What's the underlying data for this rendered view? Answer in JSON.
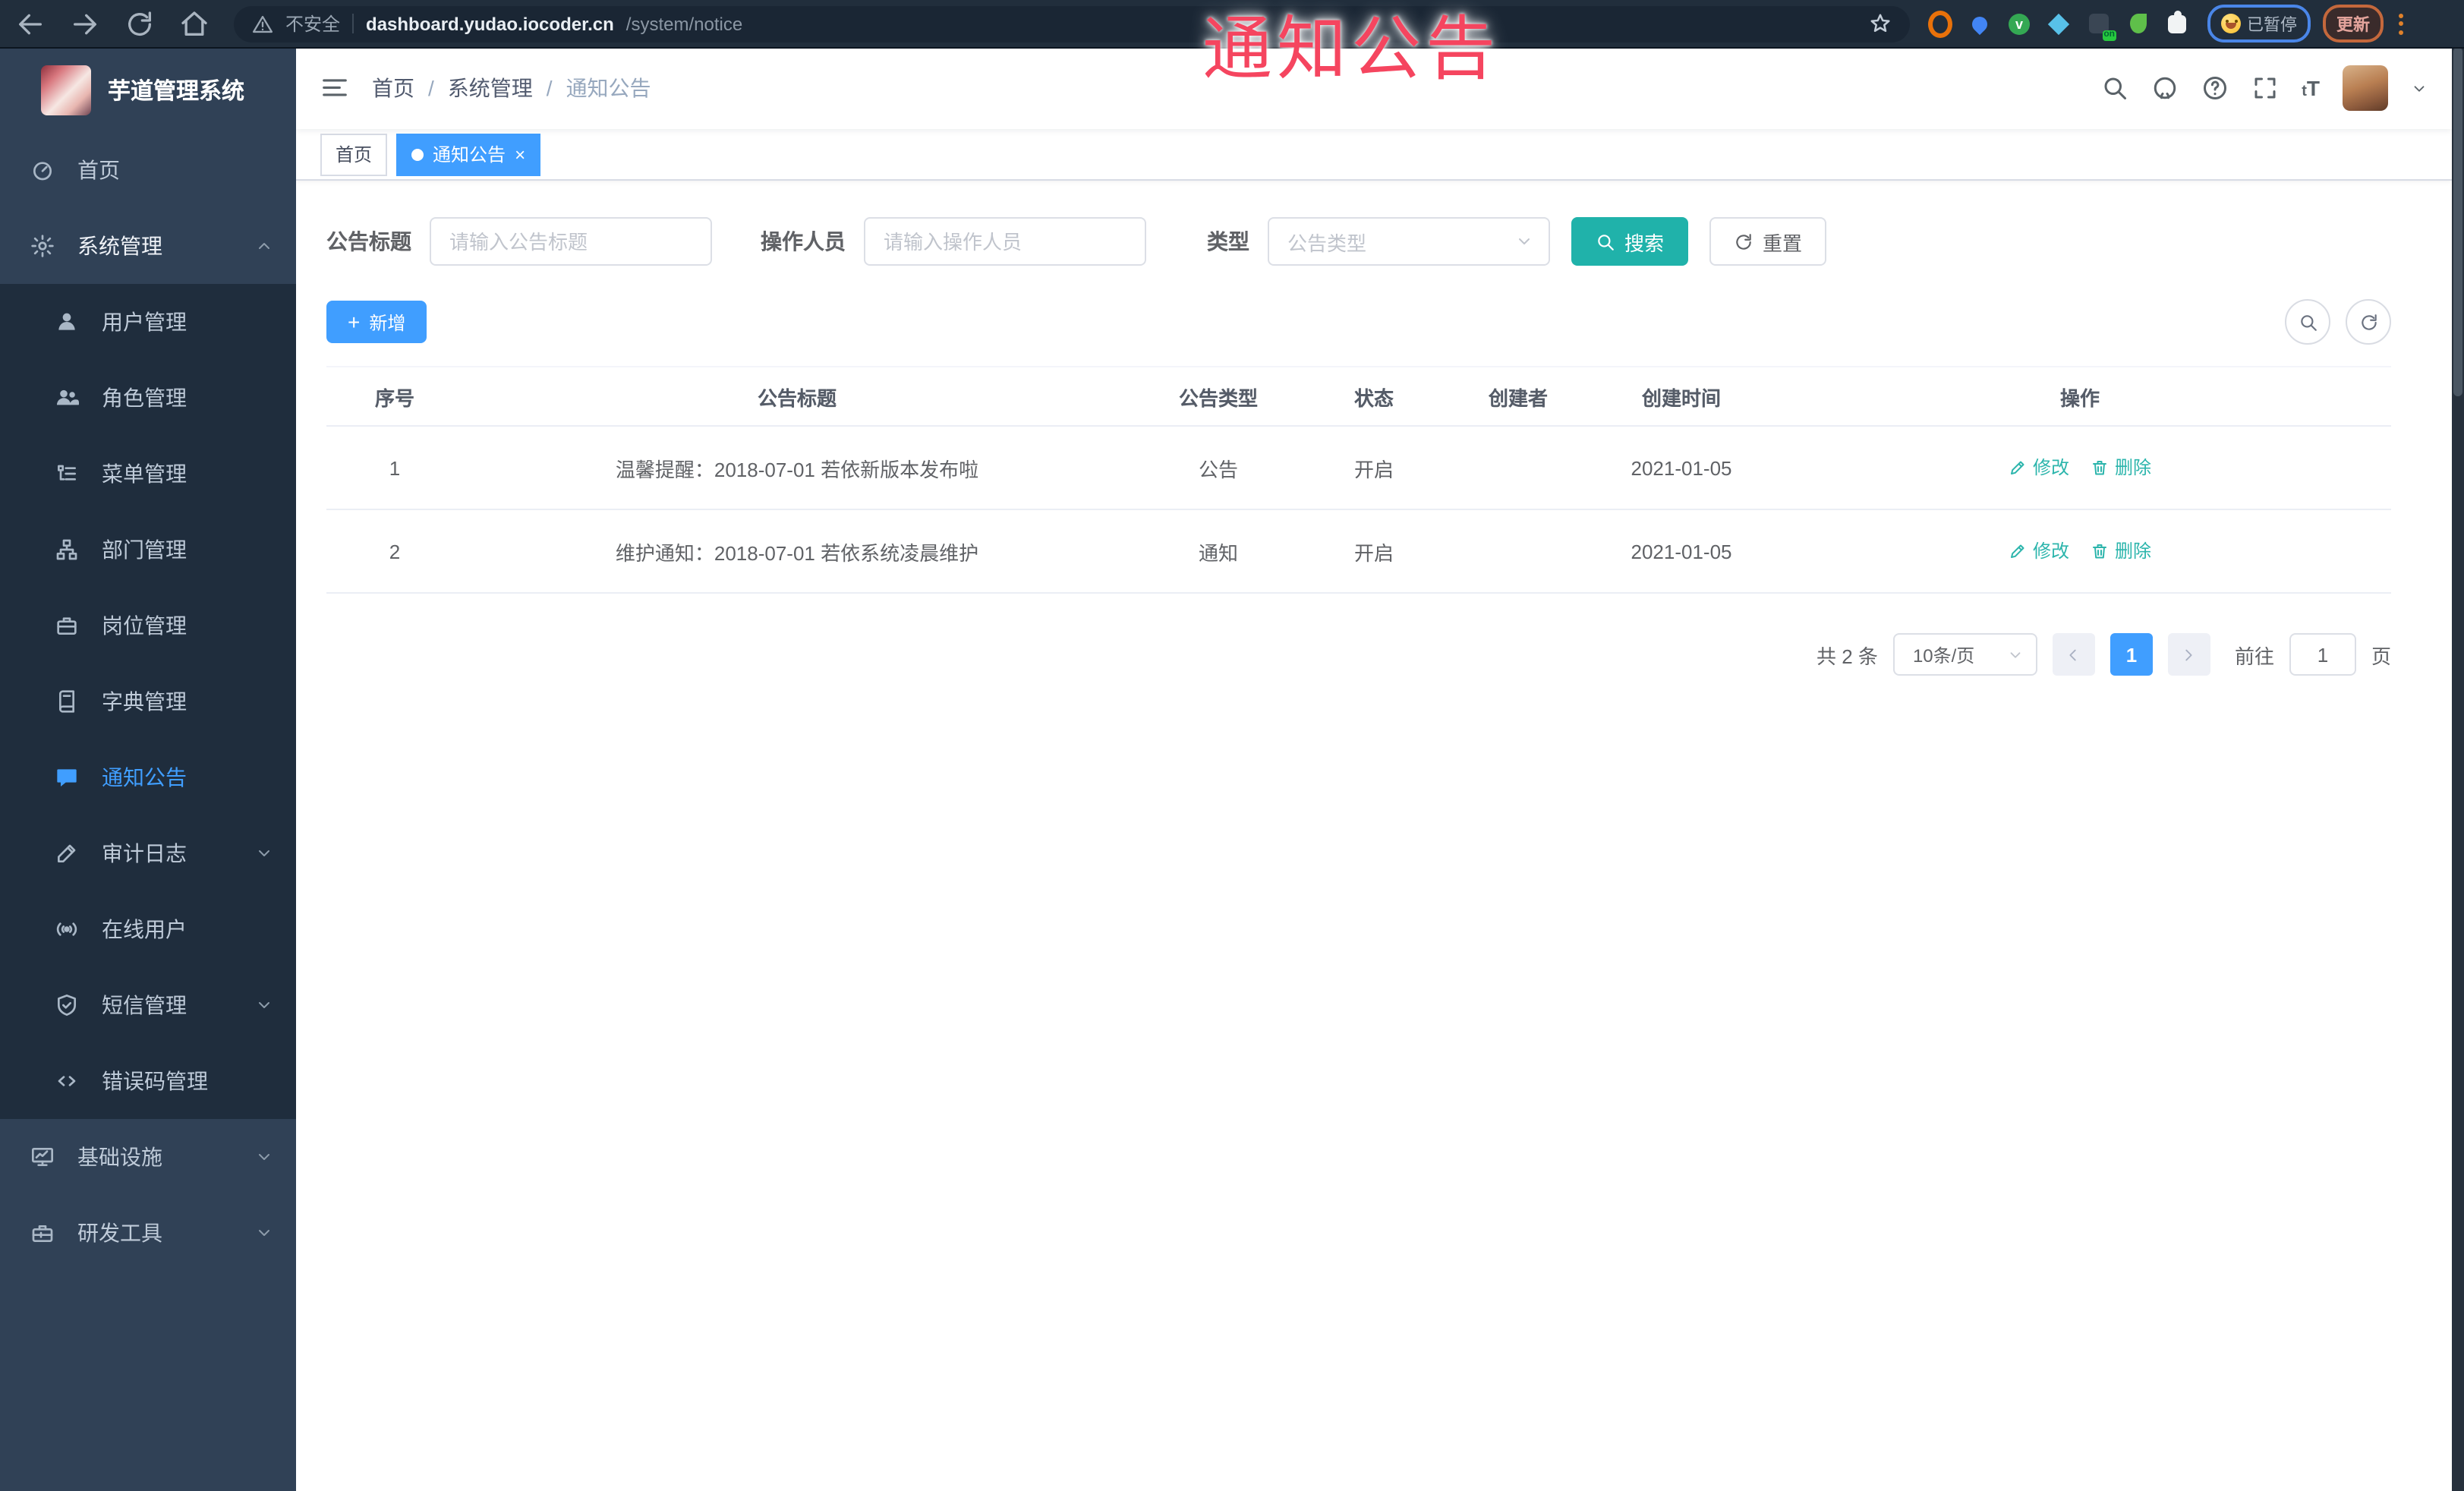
{
  "browser": {
    "security_label": "不安全",
    "url_host": "dashboard.yudao.iocoder.cn",
    "url_path": "/system/notice",
    "paused_label": "已暂停",
    "update_label": "更新",
    "nav_icons": [
      "back-icon",
      "forward-icon",
      "reload-icon",
      "home-icon"
    ],
    "extensions": [
      {
        "name": "extension-orange-ring-icon",
        "shape": "donut"
      },
      {
        "name": "extension-blue-pin-icon",
        "shape": "pin"
      },
      {
        "name": "extension-green-circle-icon",
        "shape": "circle",
        "glyph": "v"
      },
      {
        "name": "extension-blue-gem-icon",
        "shape": "diamond"
      },
      {
        "name": "extension-dark-icon",
        "shape": "square",
        "badge": "on"
      },
      {
        "name": "extension-green-leaf-icon",
        "shape": "leaf"
      },
      {
        "name": "extensions-puzzle-icon",
        "shape": "puzzle"
      }
    ]
  },
  "watermark": {
    "text": "通知公告",
    "color": "#f5455f"
  },
  "sidebar": {
    "title": "芋道管理系统",
    "items": [
      {
        "key": "home",
        "label": "首页",
        "icon": "dashboard-icon",
        "level": "top"
      },
      {
        "key": "system-management",
        "label": "系统管理",
        "icon": "gear-icon",
        "level": "top",
        "expanded": true,
        "arrow": "up"
      },
      {
        "key": "user-management",
        "label": "用户管理",
        "icon": "user-icon",
        "level": "sub"
      },
      {
        "key": "role-management",
        "label": "角色管理",
        "icon": "users-icon",
        "level": "sub"
      },
      {
        "key": "menu-management",
        "label": "菜单管理",
        "icon": "menu-tree-icon",
        "level": "sub"
      },
      {
        "key": "dept-management",
        "label": "部门管理",
        "icon": "org-tree-icon",
        "level": "sub"
      },
      {
        "key": "post-management",
        "label": "岗位管理",
        "icon": "briefcase-icon",
        "level": "sub"
      },
      {
        "key": "dict-management",
        "label": "字典管理",
        "icon": "book-icon",
        "level": "sub"
      },
      {
        "key": "notice-announcement",
        "label": "通知公告",
        "icon": "message-icon",
        "level": "sub",
        "active": true
      },
      {
        "key": "audit-log",
        "label": "审计日志",
        "icon": "edit-icon",
        "level": "sub",
        "arrow": "down"
      },
      {
        "key": "online-users",
        "label": "在线用户",
        "icon": "online-icon",
        "level": "sub"
      },
      {
        "key": "sms-management",
        "label": "短信管理",
        "icon": "shield-icon",
        "level": "sub",
        "arrow": "down"
      },
      {
        "key": "error-code-management",
        "label": "错误码管理",
        "icon": "code-icon",
        "level": "sub"
      },
      {
        "key": "infrastructure",
        "label": "基础设施",
        "icon": "monitor-icon",
        "level": "top",
        "arrow": "down"
      },
      {
        "key": "dev-tools",
        "label": "研发工具",
        "icon": "toolbox-icon",
        "level": "top",
        "arrow": "down"
      }
    ]
  },
  "header": {
    "breadcrumb": [
      "首页",
      "系统管理",
      "通知公告"
    ],
    "action_icons": [
      "search-icon",
      "github-icon",
      "help-icon",
      "fullscreen-icon",
      "font-size-icon"
    ]
  },
  "tabs": [
    {
      "key": "home",
      "label": "首页",
      "active": false,
      "closable": false
    },
    {
      "key": "notice",
      "label": "通知公告",
      "active": true,
      "closable": true
    }
  ],
  "filters": {
    "title_label": "公告标题",
    "title_placeholder": "请输入公告标题",
    "operator_label": "操作人员",
    "operator_placeholder": "请输入操作人员",
    "type_label": "类型",
    "type_placeholder": "公告类型",
    "search_label": "搜索",
    "reset_label": "重置"
  },
  "toolbar": {
    "add_label": "新增"
  },
  "table": {
    "columns": [
      "序号",
      "公告标题",
      "公告类型",
      "状态",
      "创建者",
      "创建时间",
      "操作"
    ],
    "rows": [
      {
        "no": "1",
        "title": "温馨提醒：2018-07-01 若依新版本发布啦",
        "type": "公告",
        "status": "开启",
        "creator": "",
        "created": "2021-01-05"
      },
      {
        "no": "2",
        "title": "维护通知：2018-07-01 若依系统凌晨维护",
        "type": "通知",
        "status": "开启",
        "creator": "",
        "created": "2021-01-05"
      }
    ],
    "edit_label": "修改",
    "delete_label": "删除"
  },
  "pagination": {
    "total_label": "共 2 条",
    "page_size_label": "10条/页",
    "current_page": "1",
    "goto_label": "前往",
    "goto_value": "1",
    "page_unit_label": "页"
  },
  "colors": {
    "accent": "#409eff",
    "cyan": "#20b2aa",
    "sidebar_bg": "#304156",
    "submenu_bg": "#1f2d3d",
    "watermark": "#f5455f"
  }
}
